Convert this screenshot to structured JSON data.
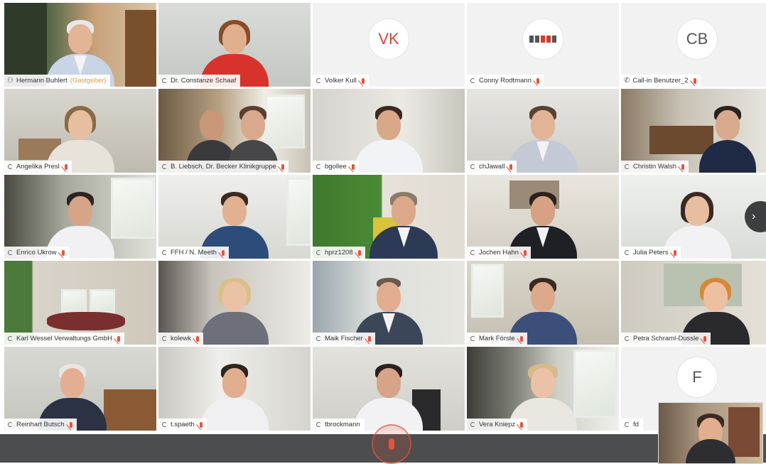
{
  "participants": [
    {
      "name": "Hermann Buhlert",
      "suffix": "(Gastgeber)",
      "type": "video",
      "icon": "people-icon"
    },
    {
      "name": "Dr. Constanze Schaaf",
      "type": "video"
    },
    {
      "name": "Volker Kull",
      "type": "initials",
      "initials": "VK",
      "initials_color": "#d9453a"
    },
    {
      "name": "Conny Rodtmann",
      "type": "logo"
    },
    {
      "name": "Call-in Benutzer_2",
      "type": "initials",
      "initials": "CB",
      "initials_color": "#555555",
      "icon": "phone-icon"
    },
    {
      "name": "Angelika Presl",
      "type": "video"
    },
    {
      "name": "B. Liebsch, Dr. Becker Klinikgruppe",
      "type": "video"
    },
    {
      "name": "bgollee",
      "type": "video"
    },
    {
      "name": "chJawall",
      "type": "video"
    },
    {
      "name": "Christin Walsh",
      "type": "video"
    },
    {
      "name": "Enrico Ukrow",
      "type": "video"
    },
    {
      "name": "FFH / N. Meeth",
      "type": "video"
    },
    {
      "name": "hprz1208",
      "type": "video"
    },
    {
      "name": "Jochen Hahn",
      "type": "video"
    },
    {
      "name": "Julia Peters",
      "type": "video"
    },
    {
      "name": "Karl Wessel Verwaltungs GmbH",
      "type": "video"
    },
    {
      "name": "kolewk",
      "type": "video"
    },
    {
      "name": "Maik Fischer",
      "type": "video"
    },
    {
      "name": "Mark Förste",
      "type": "video"
    },
    {
      "name": "Petra Schraml-Dussle",
      "type": "video"
    },
    {
      "name": "Reinhart Butsch",
      "type": "video"
    },
    {
      "name": "t.spaeth",
      "type": "video"
    },
    {
      "name": "tbrockmann",
      "type": "video"
    },
    {
      "name": "Vera Kniepz",
      "type": "video"
    },
    {
      "name": "fd",
      "type": "initials",
      "initials": "F",
      "initials_color": "#555555"
    }
  ],
  "controls": {
    "next_page_glyph": "›"
  },
  "colors": {
    "accent": "#e5533d",
    "bar": "#4b4d4f"
  }
}
